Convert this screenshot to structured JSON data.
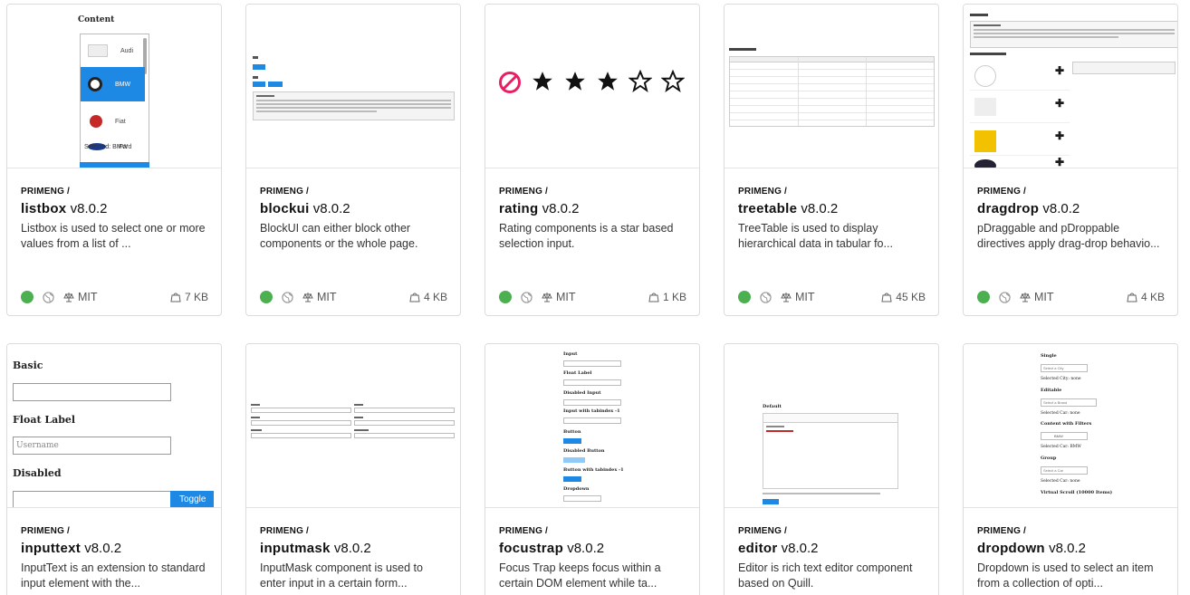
{
  "cards": [
    {
      "scope": "PRIMENG /",
      "name": "listbox",
      "version": "v8.0.2",
      "description": "Listbox is used to select one or more values from a list of ...",
      "license": "MIT",
      "size": "7 KB"
    },
    {
      "scope": "PRIMENG /",
      "name": "blockui",
      "version": "v8.0.2",
      "description": "BlockUI can either block other components or the whole page.",
      "license": "MIT",
      "size": "4 KB"
    },
    {
      "scope": "PRIMENG /",
      "name": "rating",
      "version": "v8.0.2",
      "description": "Rating components is a star based selection input.",
      "license": "MIT",
      "size": "1 KB"
    },
    {
      "scope": "PRIMENG /",
      "name": "treetable",
      "version": "v8.0.2",
      "description": "TreeTable is used to display hierarchical data in tabular fo...",
      "license": "MIT",
      "size": "45 KB"
    },
    {
      "scope": "PRIMENG /",
      "name": "dragdrop",
      "version": "v8.0.2",
      "description": "pDraggable and pDroppable directives apply drag-drop behavio...",
      "license": "MIT",
      "size": "4 KB"
    },
    {
      "scope": "PRIMENG /",
      "name": "inputtext",
      "version": "v8.0.2",
      "description": "InputText is an extension to standard input element with the..."
    },
    {
      "scope": "PRIMENG /",
      "name": "inputmask",
      "version": "v8.0.2",
      "description": "InputMask component is used to enter input in a certain form..."
    },
    {
      "scope": "PRIMENG /",
      "name": "focustrap",
      "version": "v8.0.2",
      "description": "Focus Trap keeps focus within a certain DOM element while ta..."
    },
    {
      "scope": "PRIMENG /",
      "name": "editor",
      "version": "v8.0.2",
      "description": "Editor is rich text editor component based on Quill."
    },
    {
      "scope": "PRIMENG /",
      "name": "dropdown",
      "version": "v8.0.2",
      "description": "Dropdown is used to select an item from a collection of opti..."
    }
  ],
  "previews": {
    "listbox": {
      "heading": "Content",
      "items": [
        "Audi",
        "BMW",
        "Fiat",
        "Ford"
      ],
      "selected": "Selected: BMW"
    },
    "rating": {
      "stars_filled": 3,
      "stars_total": 5
    },
    "inputtext": {
      "basic": "Basic",
      "float_label": "Float Label",
      "placeholder": "Username",
      "disabled": "Disabled",
      "toggle": "Toggle"
    },
    "editor": {
      "heading": "Default"
    },
    "dropdown": {
      "single": "Single",
      "single_placeholder": "Select a City",
      "selected_city": "Selected City: none",
      "editable": "Editable",
      "editable_placeholder": "Select a Brand",
      "selected_car1": "Selected Car: none",
      "content_filters": "Content with Filters",
      "filter_value": "BMW",
      "selected_car2": "Selected Car: BMW",
      "group": "Group",
      "group_placeholder": "Select a Car",
      "selected_car3": "Selected Car: none",
      "virtual_scroll": "Virtual Scroll (10000 Items)"
    },
    "focustrap": {
      "input": "Input",
      "float_label": "Float Label",
      "disabled_input": "Disabled Input",
      "input_tabindex": "Input with tabindex -1",
      "button": "Button",
      "disabled_button": "Disabled Button",
      "button_tabindex": "Button with tabindex -1",
      "dropdown": "Dropdown"
    }
  },
  "colors": {
    "status_green": "#4caf50",
    "brand_blue": "#1e88e5",
    "rating_cancel": "#e91e63"
  }
}
